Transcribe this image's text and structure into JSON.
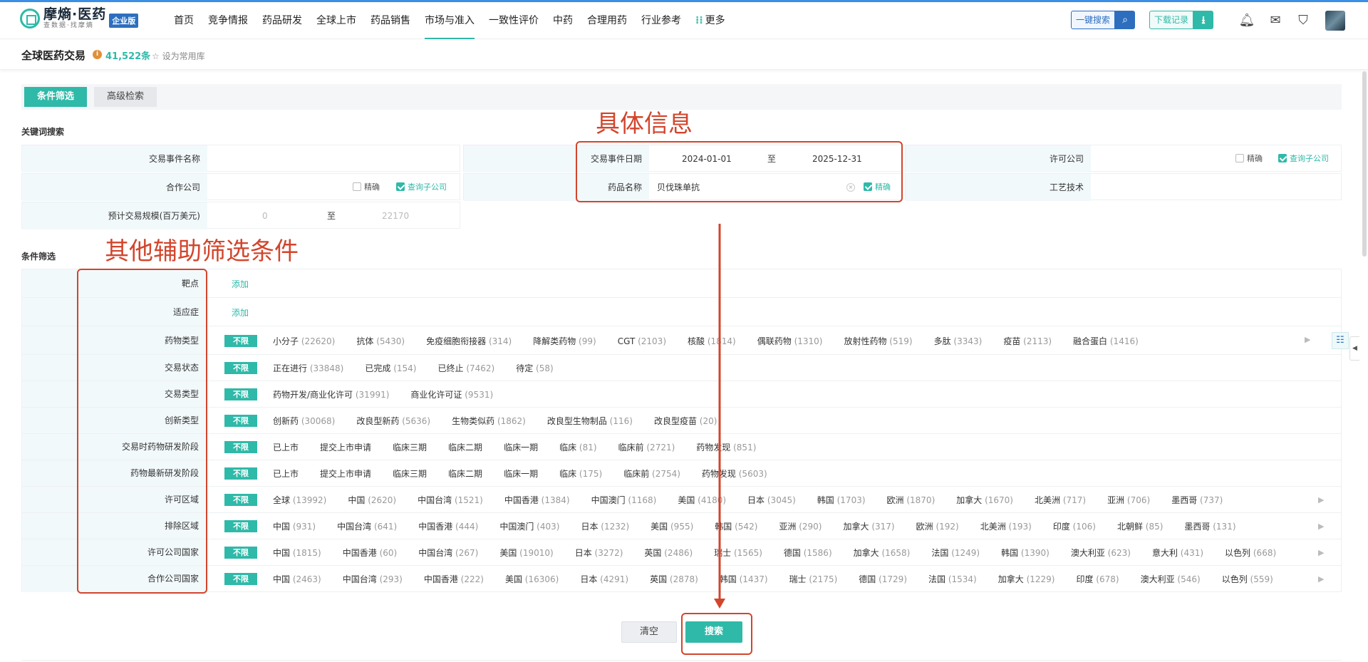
{
  "brand": {
    "name": "摩熵·医药",
    "slogan": "查数据·找摩熵",
    "badge": "企业版"
  },
  "nav": {
    "items": [
      {
        "label": "首页"
      },
      {
        "label": "竞争情报"
      },
      {
        "label": "药品研发"
      },
      {
        "label": "全球上市"
      },
      {
        "label": "药品销售"
      },
      {
        "label": "市场与准入",
        "active": true
      },
      {
        "label": "一致性评价"
      },
      {
        "label": "中药"
      },
      {
        "label": "合理用药"
      },
      {
        "label": "行业参考"
      },
      {
        "label": "更多"
      }
    ],
    "search_label": "一键搜索",
    "download_label": "下载记录"
  },
  "header": {
    "title": "全球医药交易",
    "count": "41,522条",
    "favorite": "设为常用库"
  },
  "tabs": {
    "filter": "条件筛选",
    "advanced": "高级检索"
  },
  "annotations": {
    "detail": "具体信息",
    "aux": "其他辅助筛选条件"
  },
  "keyword": {
    "section": "关键词搜索",
    "event_name_label": "交易事件名称",
    "event_date_label": "交易事件日期",
    "date_from": "2024-01-01",
    "date_sep": "至",
    "date_to": "2025-12-31",
    "licensor_label": "许可公司",
    "partner_label": "合作公司",
    "drug_name_label": "药品名称",
    "drug_name_value": "贝伐珠单抗",
    "process_label": "工艺技术",
    "scale_label": "预计交易规模(百万美元)",
    "scale_min": "0",
    "scale_sep": "至",
    "scale_max": "22170",
    "exact": "精确",
    "sub_company": "查询子公司"
  },
  "filter": {
    "section": "条件筛选",
    "unlimited": "不限",
    "add": "添加",
    "rows": [
      {
        "label": "靶点",
        "type": "add"
      },
      {
        "label": "适应症",
        "type": "add"
      },
      {
        "label": "药物类型",
        "opts": [
          [
            "小分子",
            "(22620)"
          ],
          [
            "抗体",
            "(5430)"
          ],
          [
            "免疫细胞衔接器",
            "(314)"
          ],
          [
            "降解类药物",
            "(99)"
          ],
          [
            "CGT",
            "(2103)"
          ],
          [
            "核酸",
            "(1814)"
          ],
          [
            "偶联药物",
            "(1310)"
          ],
          [
            "放射性药物",
            "(519)"
          ],
          [
            "多肽",
            "(3343)"
          ],
          [
            "疫苗",
            "(2113)"
          ],
          [
            "融合蛋白",
            "(1416)"
          ]
        ]
      },
      {
        "label": "交易状态",
        "opts": [
          [
            "正在进行",
            "(33848)"
          ],
          [
            "已完成",
            "(154)"
          ],
          [
            "已终止",
            "(7462)"
          ],
          [
            "待定",
            "(58)"
          ]
        ]
      },
      {
        "label": "交易类型",
        "opts": [
          [
            "药物开发/商业化许可",
            "(31991)"
          ],
          [
            "商业化许可证",
            "(9531)"
          ]
        ]
      },
      {
        "label": "创新类型",
        "opts": [
          [
            "创新药",
            "(30068)"
          ],
          [
            "改良型新药",
            "(5636)"
          ],
          [
            "生物类似药",
            "(1862)"
          ],
          [
            "改良型生物制品",
            "(116)"
          ],
          [
            "改良型疫苗",
            "(20)"
          ]
        ]
      },
      {
        "label": "交易时药物研发阶段",
        "opts": [
          [
            "已上市",
            ""
          ],
          [
            "提交上市申请",
            ""
          ],
          [
            "临床三期",
            ""
          ],
          [
            "临床二期",
            ""
          ],
          [
            "临床一期",
            ""
          ],
          [
            "临床",
            "(81)"
          ],
          [
            "临床前",
            "(2721)"
          ],
          [
            "药物发现",
            "(851)"
          ]
        ]
      },
      {
        "label": "药物最新研发阶段",
        "opts": [
          [
            "已上市",
            ""
          ],
          [
            "提交上市申请",
            ""
          ],
          [
            "临床三期",
            ""
          ],
          [
            "临床二期",
            ""
          ],
          [
            "临床一期",
            ""
          ],
          [
            "临床",
            "(175)"
          ],
          [
            "临床前",
            "(2754)"
          ],
          [
            "药物发现",
            "(5603)"
          ]
        ]
      },
      {
        "label": "许可区域",
        "opts": [
          [
            "全球",
            "(13992)"
          ],
          [
            "中国",
            "(2620)"
          ],
          [
            "中国台湾",
            "(1521)"
          ],
          [
            "中国香港",
            "(1384)"
          ],
          [
            "中国澳门",
            "(1168)"
          ],
          [
            "美国",
            "(4180)"
          ],
          [
            "日本",
            "(3045)"
          ],
          [
            "韩国",
            "(1703)"
          ],
          [
            "欧洲",
            "(1870)"
          ],
          [
            "加拿大",
            "(1670)"
          ],
          [
            "北美洲",
            "(717)"
          ],
          [
            "亚洲",
            "(706)"
          ],
          [
            "墨西哥",
            "(737)"
          ]
        ]
      },
      {
        "label": "排除区域",
        "opts": [
          [
            "中国",
            "(931)"
          ],
          [
            "中国台湾",
            "(641)"
          ],
          [
            "中国香港",
            "(444)"
          ],
          [
            "中国澳门",
            "(403)"
          ],
          [
            "日本",
            "(1232)"
          ],
          [
            "美国",
            "(955)"
          ],
          [
            "韩国",
            "(542)"
          ],
          [
            "亚洲",
            "(290)"
          ],
          [
            "加拿大",
            "(317)"
          ],
          [
            "欧洲",
            "(192)"
          ],
          [
            "北美洲",
            "(193)"
          ],
          [
            "印度",
            "(106)"
          ],
          [
            "北朝鲜",
            "(85)"
          ],
          [
            "墨西哥",
            "(131)"
          ]
        ]
      },
      {
        "label": "许可公司国家",
        "opts": [
          [
            "中国",
            "(1815)"
          ],
          [
            "中国香港",
            "(60)"
          ],
          [
            "中国台湾",
            "(267)"
          ],
          [
            "美国",
            "(19010)"
          ],
          [
            "日本",
            "(3272)"
          ],
          [
            "英国",
            "(2486)"
          ],
          [
            "瑞士",
            "(1565)"
          ],
          [
            "德国",
            "(1586)"
          ],
          [
            "加拿大",
            "(1658)"
          ],
          [
            "法国",
            "(1249)"
          ],
          [
            "韩国",
            "(1390)"
          ],
          [
            "澳大利亚",
            "(623)"
          ],
          [
            "意大利",
            "(431)"
          ],
          [
            "以色列",
            "(668)"
          ]
        ]
      },
      {
        "label": "合作公司国家",
        "opts": [
          [
            "中国",
            "(2463)"
          ],
          [
            "中国台湾",
            "(293)"
          ],
          [
            "中国香港",
            "(222)"
          ],
          [
            "美国",
            "(16306)"
          ],
          [
            "日本",
            "(4291)"
          ],
          [
            "英国",
            "(2878)"
          ],
          [
            "韩国",
            "(1437)"
          ],
          [
            "瑞士",
            "(2175)"
          ],
          [
            "德国",
            "(1729)"
          ],
          [
            "法国",
            "(1534)"
          ],
          [
            "加拿大",
            "(1229)"
          ],
          [
            "印度",
            "(678)"
          ],
          [
            "澳大利亚",
            "(546)"
          ],
          [
            "以色列",
            "(559)"
          ]
        ]
      }
    ]
  },
  "actions": {
    "clear": "清空",
    "search": "搜索"
  },
  "colors": {
    "accent": "#2fb9a8",
    "brand_blue": "#2d6fbe",
    "annotation": "#d2452c"
  }
}
